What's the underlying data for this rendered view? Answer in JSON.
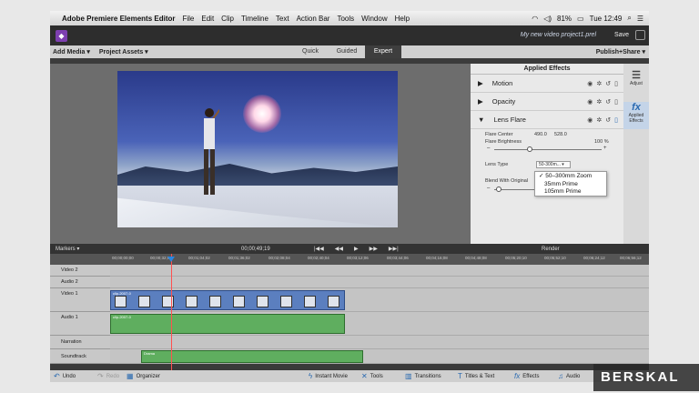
{
  "menubar": {
    "app_name": "Adobe Premiere Elements Editor",
    "items": [
      "File",
      "Edit",
      "Clip",
      "Timeline",
      "Text",
      "Action Bar",
      "Tools",
      "Window",
      "Help"
    ],
    "battery": "81%",
    "clock": "Tue 12:49"
  },
  "titlebar": {
    "project": "My new video project1.prel",
    "save": "Save"
  },
  "modebar": {
    "add_media": "Add Media ▾",
    "project_assets": "Project Assets ▾",
    "modes": [
      "Quick",
      "Guided",
      "Expert"
    ],
    "active_mode": "Expert",
    "publish": "Publish+Share ▾"
  },
  "effects_panel": {
    "title": "Applied Effects",
    "rows": [
      {
        "label": "Motion",
        "arrow": "▶"
      },
      {
        "label": "Opacity",
        "arrow": "▶"
      },
      {
        "label": "Lens Flare",
        "arrow": "▼"
      }
    ],
    "props": {
      "flare_center_label": "Flare Center",
      "flare_center_x": "490.0",
      "flare_center_y": "528.0",
      "flare_brightness_label": "Flare Brightness",
      "flare_brightness_value": "100 %",
      "lens_type_label": "Lens Type",
      "lens_type_value": "50-300m... ▾",
      "blend_label": "Blend With Original"
    },
    "lens_options": [
      "✓ 50–300mm Zoom",
      "35mm Prime",
      "105mm Prime"
    ]
  },
  "rightbar": {
    "adjust": "Adjust",
    "applied": "Applied Effects"
  },
  "timeline": {
    "markers": "Markers ▾",
    "timecode": "00;00;49;19",
    "transport": [
      "|◀◀",
      "◀◀",
      "▶",
      "▶▶",
      "▶▶|"
    ],
    "render": "Render",
    "ticks": [
      "00;00;00;00",
      "00;00;32;00",
      "00;01;04;02",
      "00;01;36;02",
      "00;02;08;04",
      "00;02;40;04",
      "00;03;12;06",
      "00;03;44;06",
      "00;04;16;08",
      "00;04;48;08",
      "00;05;20;10",
      "00;05;52;10",
      "00;06;24;12",
      "00;06;56;12"
    ],
    "tracks": [
      "Video 2",
      "Audio 2",
      "Video 1",
      "Audio 1",
      "Narration",
      "Soundtrack"
    ],
    "clip_label": "clip-2007-0",
    "soundtrack_clip": "Drama"
  },
  "bottombar": {
    "undo": "Undo",
    "redo": "Redo",
    "organizer": "Organizer",
    "instant_movie": "Instant Movie",
    "tools": "Tools",
    "transitions": "Transitions",
    "titles": "Titles & Text",
    "effects": "Effects",
    "audio": "Audio"
  },
  "watermark": "BERSKAL"
}
